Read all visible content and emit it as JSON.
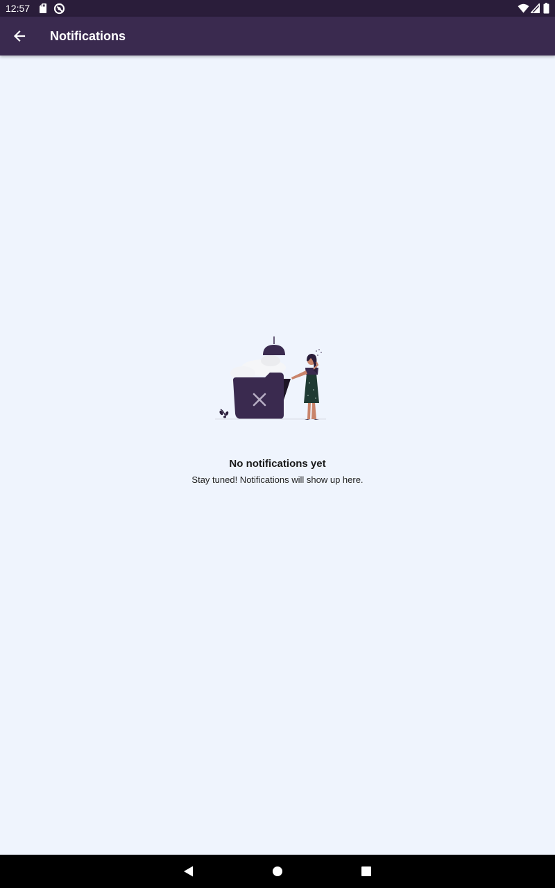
{
  "status_bar": {
    "time": "12:57",
    "left_icons": [
      "sd-card-icon",
      "data-saver-icon"
    ],
    "right_icons": [
      "wifi-icon",
      "cell-signal-icon",
      "battery-icon"
    ]
  },
  "app_bar": {
    "title": "Notifications",
    "back_icon": "arrow-back-icon"
  },
  "empty_state": {
    "title": "No notifications yet",
    "subtitle": "Stay tuned! Notifications will show up here."
  },
  "nav_bar": {
    "buttons": [
      "back-triangle-icon",
      "home-circle-icon",
      "recents-square-icon"
    ]
  },
  "colors": {
    "status_bar": "#2a1d3a",
    "app_bar": "#3a2a4f",
    "background": "#eff4fd",
    "accent": "#3a2a4f"
  }
}
